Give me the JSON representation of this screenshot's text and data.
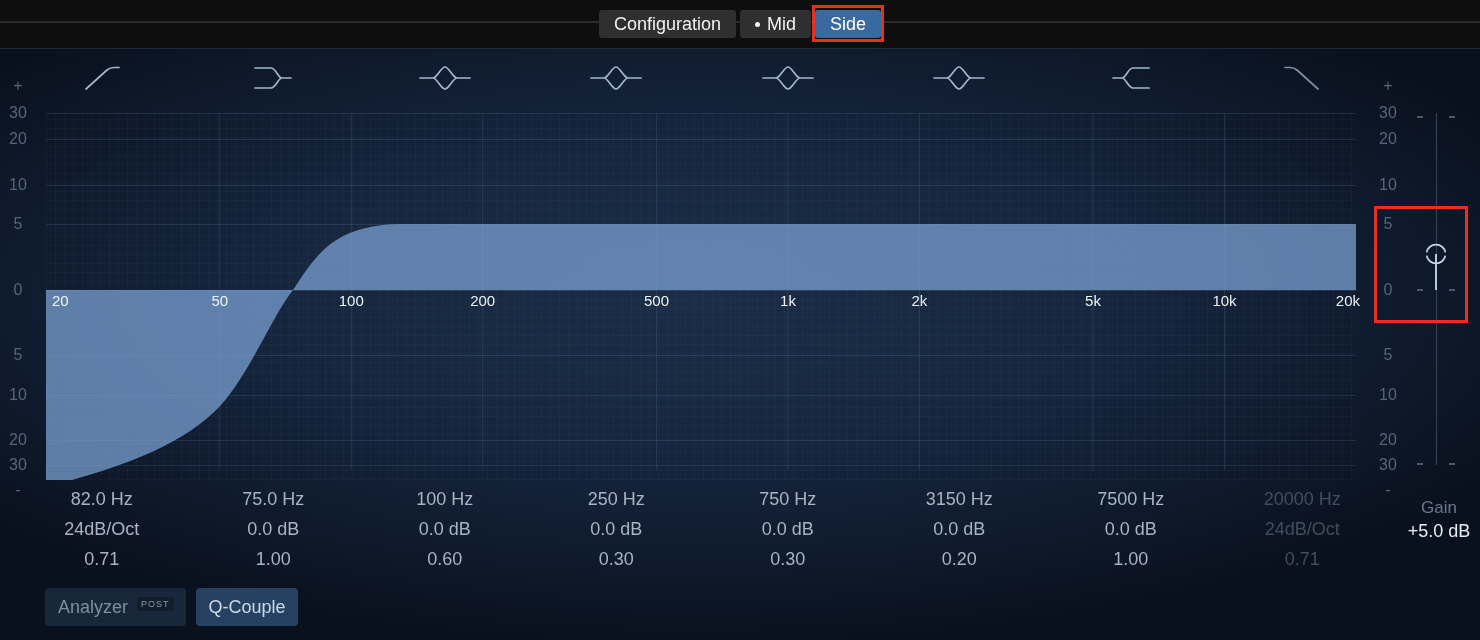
{
  "tabs": [
    {
      "label": "Configuration",
      "selected": false,
      "modified": false,
      "highlighted": false
    },
    {
      "label": "Mid",
      "selected": false,
      "modified": true,
      "highlighted": false
    },
    {
      "label": "Side",
      "selected": true,
      "modified": false,
      "highlighted": true
    }
  ],
  "bands": [
    {
      "kind": "low-cut",
      "enabled": true,
      "frequency": "82.0 Hz",
      "gain_or_slope": "24dB/Oct",
      "q": "0.71"
    },
    {
      "kind": "low-shelf",
      "enabled": true,
      "frequency": "75.0 Hz",
      "gain_or_slope": "0.0 dB",
      "q": "1.00"
    },
    {
      "kind": "bell",
      "enabled": true,
      "frequency": "100 Hz",
      "gain_or_slope": "0.0 dB",
      "q": "0.60"
    },
    {
      "kind": "bell",
      "enabled": true,
      "frequency": "250 Hz",
      "gain_or_slope": "0.0 dB",
      "q": "0.30"
    },
    {
      "kind": "bell",
      "enabled": true,
      "frequency": "750 Hz",
      "gain_or_slope": "0.0 dB",
      "q": "0.30"
    },
    {
      "kind": "bell",
      "enabled": true,
      "frequency": "3150 Hz",
      "gain_or_slope": "0.0 dB",
      "q": "0.20"
    },
    {
      "kind": "high-shelf",
      "enabled": true,
      "frequency": "7500 Hz",
      "gain_or_slope": "0.0 dB",
      "q": "1.00"
    },
    {
      "kind": "high-cut",
      "enabled": false,
      "frequency": "20000 Hz",
      "gain_or_slope": "24dB/Oct",
      "q": "0.71"
    }
  ],
  "scales": [
    {
      "plus": "+",
      "labels": [
        "30",
        "20",
        "10",
        "5",
        "0",
        "5",
        "10",
        "20",
        "30"
      ],
      "minus": "-"
    },
    {
      "plus": "+",
      "labels": [
        "30",
        "20",
        "10",
        "5",
        "0",
        "5",
        "10",
        "20",
        "30"
      ],
      "minus": "-"
    }
  ],
  "graph": {
    "frequency_labels": [
      "20",
      "50",
      "100",
      "200",
      "500",
      "1k",
      "2k",
      "5k",
      "10k",
      "20k"
    ]
  },
  "gain": {
    "label": "Gain",
    "value": "+5.0 dB",
    "level": 0.6,
    "highlighted": true
  },
  "buttons": [
    {
      "label": "Analyzer",
      "badge": "POST",
      "on": false
    },
    {
      "label": "Q-Couple",
      "on": true
    }
  ]
}
